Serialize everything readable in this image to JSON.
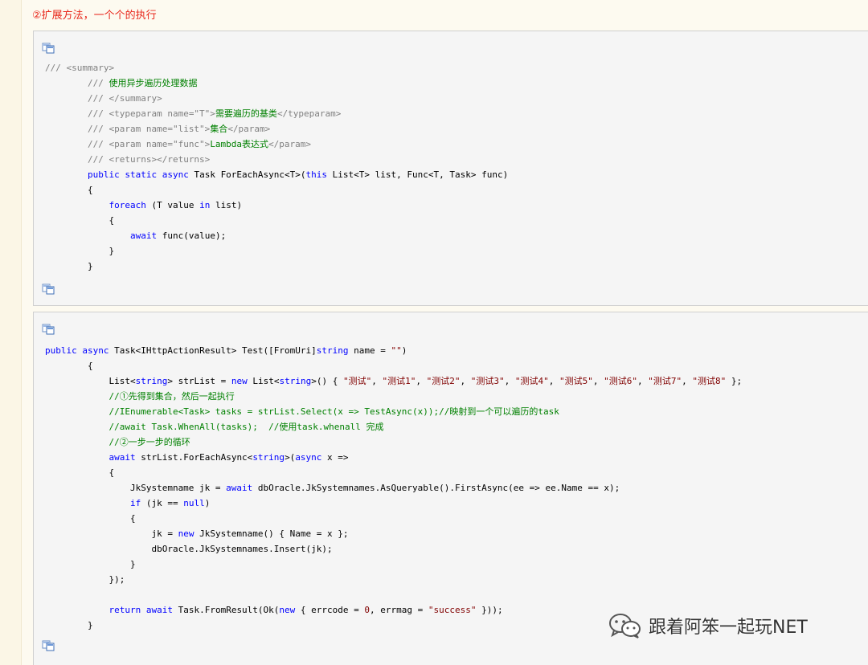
{
  "heading": "②扩展方法，一个个的执行",
  "watermark": "跟着阿笨一起玩NET",
  "code1": [
    [
      [
        "c",
        "/// <summary>"
      ]
    ],
    [
      [
        "n",
        "        "
      ],
      [
        "c",
        "/// "
      ],
      [
        "g",
        "使用异步遍历处理数据"
      ]
    ],
    [
      [
        "n",
        "        "
      ],
      [
        "c",
        "/// </summary>"
      ]
    ],
    [
      [
        "n",
        "        "
      ],
      [
        "c",
        "/// <typeparam name=\"T\">"
      ],
      [
        "g",
        "需要遍历的基类"
      ],
      [
        "c",
        "</typeparam>"
      ]
    ],
    [
      [
        "n",
        "        "
      ],
      [
        "c",
        "/// <param name=\"list\">"
      ],
      [
        "g",
        "集合"
      ],
      [
        "c",
        "</param>"
      ]
    ],
    [
      [
        "n",
        "        "
      ],
      [
        "c",
        "/// <param name=\"func\">"
      ],
      [
        "g",
        "Lambda表达式"
      ],
      [
        "c",
        "</param>"
      ]
    ],
    [
      [
        "n",
        "        "
      ],
      [
        "c",
        "/// <returns></returns>"
      ]
    ],
    [
      [
        "n",
        "        "
      ],
      [
        "k",
        "public static async"
      ],
      [
        "n",
        " Task ForEachAsync<T>("
      ],
      [
        "k",
        "this"
      ],
      [
        "n",
        " List<T> list, Func<T, Task> func)"
      ]
    ],
    [
      [
        "n",
        "        {"
      ]
    ],
    [
      [
        "n",
        "            "
      ],
      [
        "k",
        "foreach"
      ],
      [
        "n",
        " (T value "
      ],
      [
        "k",
        "in"
      ],
      [
        "n",
        " list)"
      ]
    ],
    [
      [
        "n",
        "            {"
      ]
    ],
    [
      [
        "n",
        "                "
      ],
      [
        "k",
        "await"
      ],
      [
        "n",
        " func(value);"
      ]
    ],
    [
      [
        "n",
        "            }"
      ]
    ],
    [
      [
        "n",
        "        }"
      ]
    ]
  ],
  "code2": [
    [
      [
        "k",
        "public async"
      ],
      [
        "n",
        " Task<IHttpActionResult> Test([FromUri]"
      ],
      [
        "k",
        "string"
      ],
      [
        "n",
        " name = "
      ],
      [
        "s",
        "\"\""
      ],
      [
        "n",
        ")"
      ]
    ],
    [
      [
        "n",
        "        {"
      ]
    ],
    [
      [
        "n",
        "            List<"
      ],
      [
        "k",
        "string"
      ],
      [
        "n",
        "> strList = "
      ],
      [
        "k",
        "new"
      ],
      [
        "n",
        " List<"
      ],
      [
        "k",
        "string"
      ],
      [
        "n",
        ">() { "
      ],
      [
        "s",
        "\"测试\""
      ],
      [
        "n",
        ", "
      ],
      [
        "s",
        "\"测试1\""
      ],
      [
        "n",
        ", "
      ],
      [
        "s",
        "\"测试2\""
      ],
      [
        "n",
        ", "
      ],
      [
        "s",
        "\"测试3\""
      ],
      [
        "n",
        ", "
      ],
      [
        "s",
        "\"测试4\""
      ],
      [
        "n",
        ", "
      ],
      [
        "s",
        "\"测试5\""
      ],
      [
        "n",
        ", "
      ],
      [
        "s",
        "\"测试6\""
      ],
      [
        "n",
        ", "
      ],
      [
        "s",
        "\"测试7\""
      ],
      [
        "n",
        ", "
      ],
      [
        "s",
        "\"测试8\""
      ],
      [
        "n",
        " };"
      ]
    ],
    [
      [
        "n",
        "            "
      ],
      [
        "g",
        "//①先得到集合，然后一起执行"
      ]
    ],
    [
      [
        "n",
        "            "
      ],
      [
        "g",
        "//IEnumerable<Task> tasks = strList.Select(x => TestAsync(x));//映射到一个可以遍历的task"
      ]
    ],
    [
      [
        "n",
        "            "
      ],
      [
        "g",
        "//await Task.WhenAll(tasks);  //使用task.whenall 完成"
      ]
    ],
    [
      [
        "n",
        "            "
      ],
      [
        "g",
        "//②一步一步的循环"
      ]
    ],
    [
      [
        "n",
        "            "
      ],
      [
        "k",
        "await"
      ],
      [
        "n",
        " strList.ForEachAsync<"
      ],
      [
        "k",
        "string"
      ],
      [
        "n",
        ">("
      ],
      [
        "k",
        "async"
      ],
      [
        "n",
        " x =>"
      ]
    ],
    [
      [
        "n",
        "            {"
      ]
    ],
    [
      [
        "n",
        "                JkSystemname jk = "
      ],
      [
        "k",
        "await"
      ],
      [
        "n",
        " dbOracle.JkSystemnames.AsQueryable().FirstAsync(ee => ee.Name == x);"
      ]
    ],
    [
      [
        "n",
        "                "
      ],
      [
        "k",
        "if"
      ],
      [
        "n",
        " (jk == "
      ],
      [
        "k",
        "null"
      ],
      [
        "n",
        ")"
      ]
    ],
    [
      [
        "n",
        "                {"
      ]
    ],
    [
      [
        "n",
        "                    jk = "
      ],
      [
        "k",
        "new"
      ],
      [
        "n",
        " JkSystemname() { Name = x };"
      ]
    ],
    [
      [
        "n",
        "                    dbOracle.JkSystemnames.Insert(jk);"
      ]
    ],
    [
      [
        "n",
        "                }"
      ]
    ],
    [
      [
        "n",
        "            });"
      ]
    ],
    [
      [
        "n",
        ""
      ]
    ],
    [
      [
        "n",
        "            "
      ],
      [
        "k",
        "return await"
      ],
      [
        "n",
        " Task.FromResult(Ok("
      ],
      [
        "k",
        "new"
      ],
      [
        "n",
        " { errcode = "
      ],
      [
        "s",
        "0"
      ],
      [
        "n",
        ", errmag = "
      ],
      [
        "s",
        "\"success\""
      ],
      [
        "n",
        " }));"
      ]
    ],
    [
      [
        "n",
        "        }"
      ]
    ]
  ],
  "icons": [
    "copy-code-icon",
    "wechat-icon"
  ]
}
